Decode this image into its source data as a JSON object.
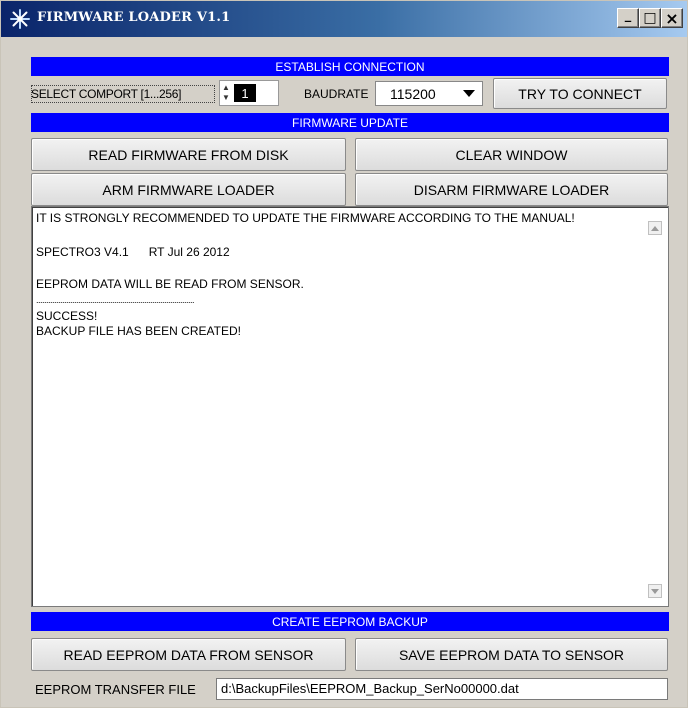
{
  "window": {
    "title": "FIRMWARE LOADER V1.1",
    "minimize_glyph": "_",
    "maximize_glyph": "□",
    "close_glyph": "×"
  },
  "connection": {
    "banner": "ESTABLISH CONNECTION",
    "comport_label": "SELECT COMPORT [1...256]",
    "comport_value": "1",
    "baudrate_label": "BAUDRATE",
    "baudrate_value": "115200",
    "try_connect": "TRY TO CONNECT"
  },
  "firmware": {
    "banner": "FIRMWARE UPDATE",
    "read_disk": "READ FIRMWARE FROM DISK",
    "clear_window": "CLEAR WINDOW",
    "arm": "ARM FIRMWARE LOADER",
    "disarm": "DISARM FIRMWARE LOADER"
  },
  "log": {
    "lines": [
      "IT IS STRONGLY RECOMMENDED TO UPDATE THE FIRMWARE ACCORDING TO THE MANUAL!",
      "SPECTRO3 V4.1      RT Jul 26 2012",
      "EEPROM DATA WILL BE READ FROM SENSOR.",
      "...............................................................................",
      "SUCCESS!",
      "BACKUP FILE HAS BEEN CREATED!"
    ]
  },
  "backup": {
    "banner": "CREATE EEPROM BACKUP",
    "read_eeprom": "READ EEPROM DATA FROM SENSOR",
    "save_eeprom": "SAVE EEPROM DATA TO SENSOR",
    "file_label": "EEPROM TRANSFER FILE",
    "file_value": "d:\\BackupFiles\\EEPROM_Backup_SerNo00000.dat"
  },
  "icons": {
    "app": "starburst-icon",
    "spin": "spin-arrows-icon",
    "dropdown": "triangle-down-icon",
    "scroll_up": "scroll-up-icon",
    "scroll_down": "scroll-down-icon"
  },
  "colors": {
    "banner": "#0000ff",
    "titlebar_start": "#0a246a",
    "titlebar_end": "#a6caf0",
    "window_bg": "#d4d0c8"
  }
}
